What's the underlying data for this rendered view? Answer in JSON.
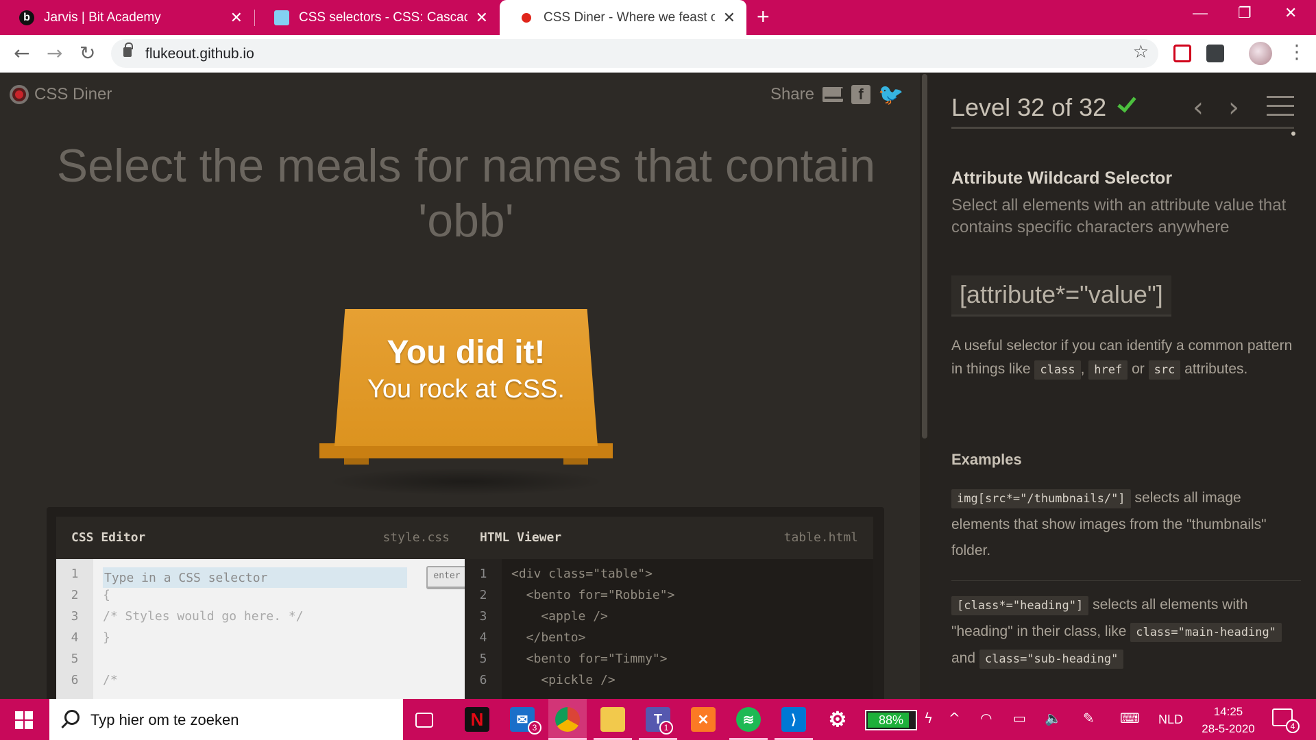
{
  "browser": {
    "tabs": [
      {
        "title": "Jarvis | Bit Academy",
        "favicon": "b",
        "active": false
      },
      {
        "title": "CSS selectors - CSS: Cascading St",
        "favicon": "mdn-icon",
        "active": false
      },
      {
        "title": "CSS Diner - Where we feast on C",
        "favicon": "red-dot-icon",
        "active": true
      }
    ],
    "tab_close": "✕",
    "new_tab": "+",
    "url": "flukeout.github.io"
  },
  "header": {
    "logo_text": "CSS Diner",
    "share_label": "Share"
  },
  "order": "Select the meals for names that contain 'obb'",
  "table": {
    "message_line1": "You did it!",
    "message_line2": "You rock at CSS."
  },
  "css_editor": {
    "title": "CSS Editor",
    "filename": "style.css",
    "placeholder": "Type in a CSS selector",
    "enter_label": "enter",
    "line_numbers": [
      "1",
      "2",
      "3",
      "4",
      "5",
      "6"
    ],
    "lines": [
      "",
      "{",
      "/* Styles would go here. */",
      "}",
      "",
      "/*"
    ]
  },
  "html_viewer": {
    "title": "HTML Viewer",
    "filename": "table.html",
    "line_numbers": [
      "1",
      "2",
      "3",
      "4",
      "5",
      "6"
    ],
    "lines": [
      "<div class=\"table\">",
      "  <bento for=\"Robbie\">",
      "    <apple />",
      "  </bento>",
      "  <bento for=\"Timmy\">",
      "    <pickle />"
    ]
  },
  "sidebar": {
    "level_text": "Level 32 of 32",
    "selector_name": "Attribute Wildcard Selector",
    "selector_desc": "Select all elements with an attribute value that contains specific characters anywhere",
    "syntax": "[attribute*=\"value\"]",
    "usage_prefix": "A useful selector if you can identify a common pattern in things like",
    "usage_code1": "class",
    "usage_sep1": ",",
    "usage_code2": "href",
    "usage_sep2": "or",
    "usage_code3": "src",
    "usage_suffix": "attributes.",
    "examples_title": "Examples",
    "example1_code": "img[src*=\"/thumbnails/\"]",
    "example1_text": "selects all image elements that show images from the \"thumbnails\" folder.",
    "example2_code": "[class*=\"heading\"]",
    "example2_text1": "selects all elements with \"heading\" in their class, like",
    "example2_code2": "class=\"main-heading\"",
    "example2_and": "and",
    "example2_code3": "class=\"sub-heading\""
  },
  "taskbar": {
    "search_placeholder": "Typ hier om te zoeken",
    "mail_badge": "3",
    "teams_badge": "1",
    "battery_pct": "88%",
    "language": "NLD",
    "time": "14:25",
    "date": "28-5-2020",
    "notifications": "4"
  },
  "colors": {
    "accent": "#c8095a",
    "table": "#e29a2b",
    "check": "#4cbf3e"
  }
}
